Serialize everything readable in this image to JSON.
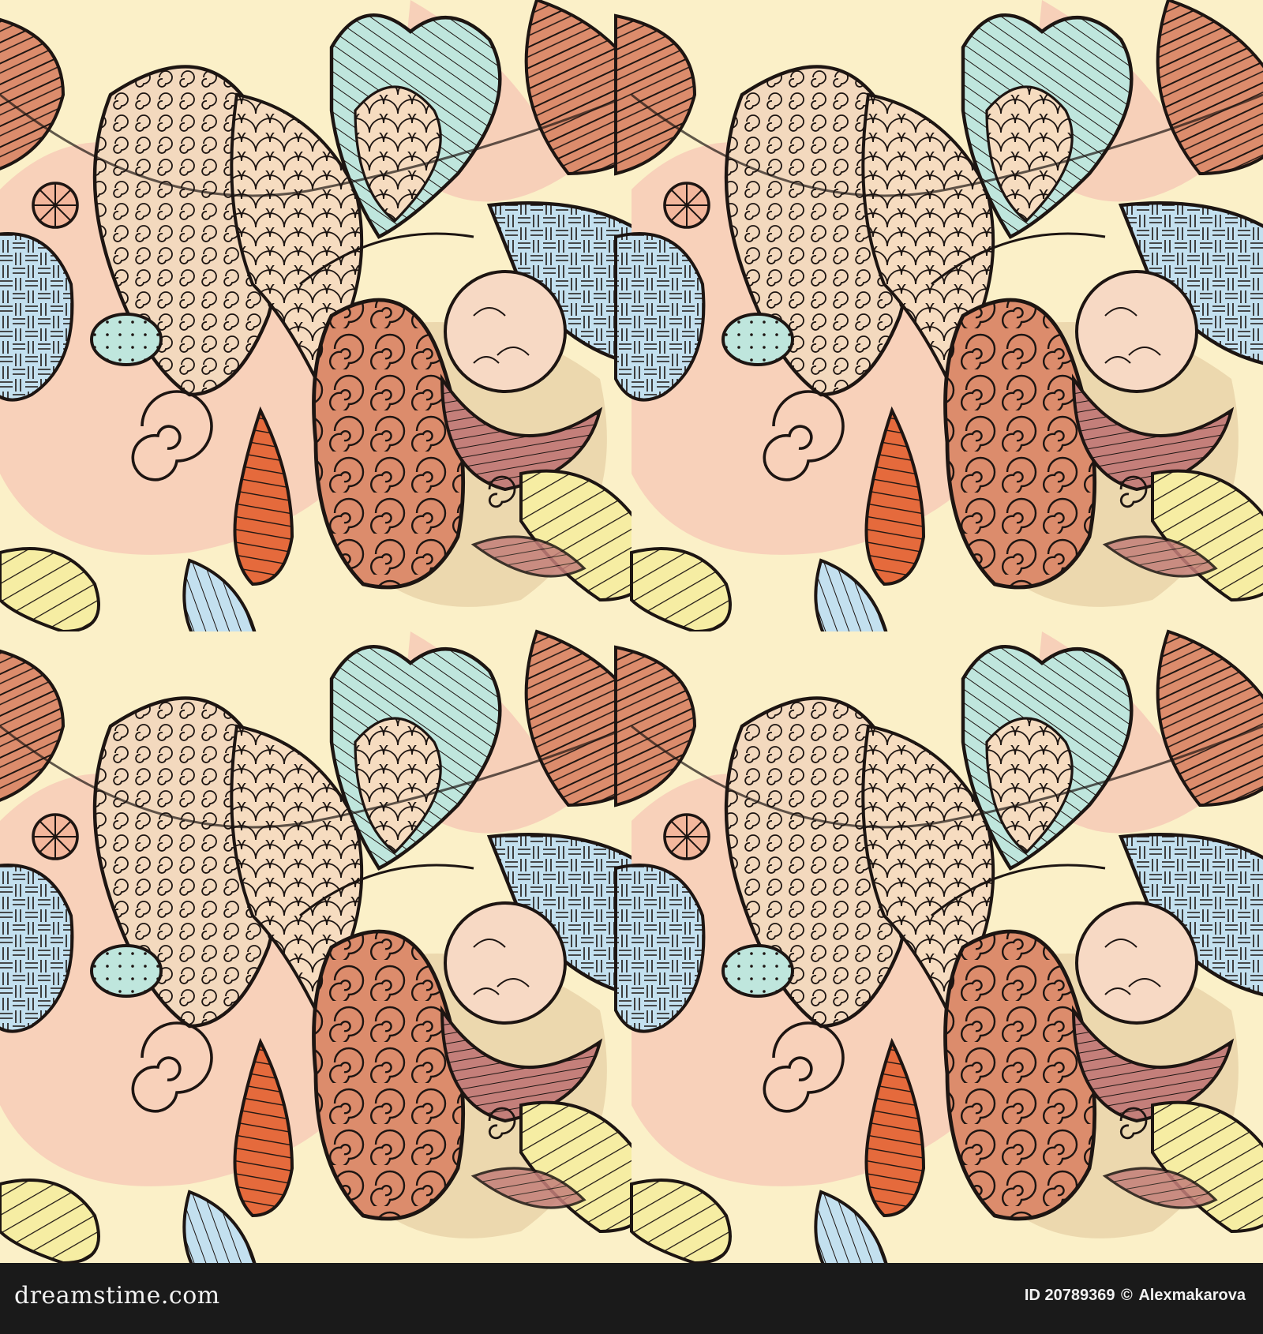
{
  "image": {
    "subject": "seamless paisley doodle pattern",
    "palette": {
      "background_cream": "#fbf0c8",
      "peach": "#f7cdb8",
      "blush": "#f5c2b2",
      "sand": "#e8d2a8",
      "terracotta": "#dc8c6c",
      "orange": "#e56a3c",
      "mint": "#bfe6dd",
      "sky": "#c3e0ef",
      "lemon": "#f6eda3",
      "mauve": "#a86a6a",
      "ink": "#1d1512"
    },
    "tile_repeat": "2x2"
  },
  "footer": {
    "logo_text": "dreamstime.com",
    "id_text": "ID 20789369",
    "copyright_symbol": "©",
    "author": "Alexmakarova"
  }
}
